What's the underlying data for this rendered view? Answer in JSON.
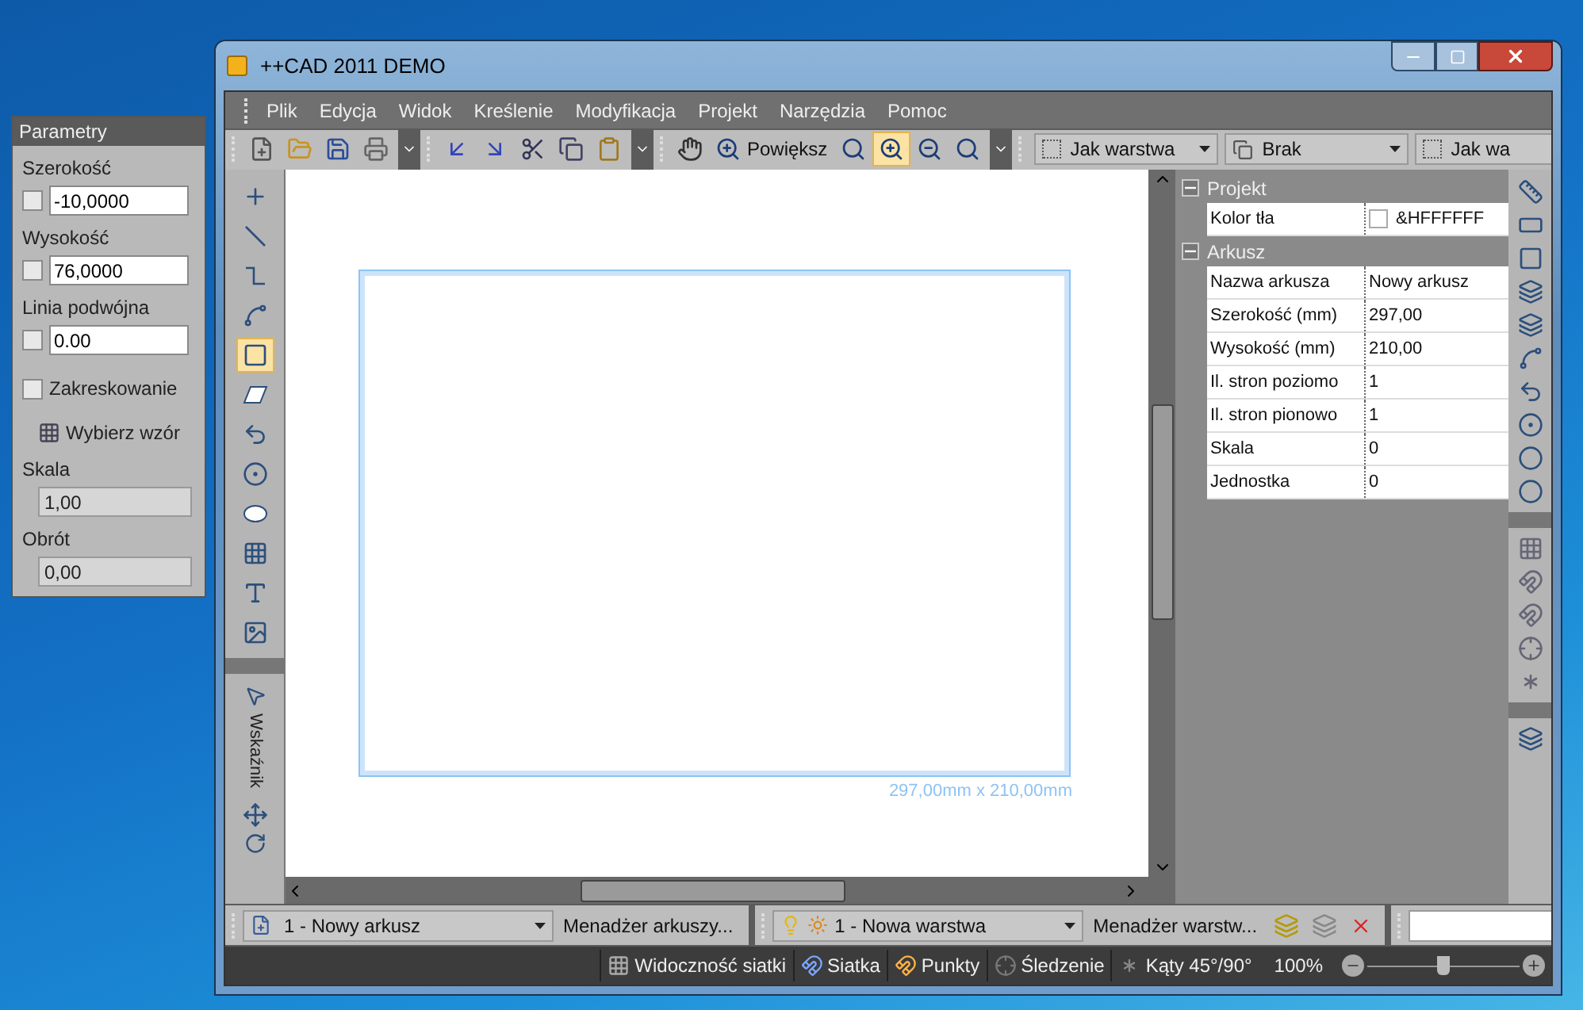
{
  "params_panel": {
    "title": "Parametry",
    "fields": [
      {
        "label": "Szerokość",
        "checked": false,
        "value": "-10,0000"
      },
      {
        "label": "Wysokość",
        "checked": false,
        "value": "76,0000"
      },
      {
        "label": "Linia podwójna",
        "checked": false,
        "value": "0.00"
      }
    ],
    "hatching": {
      "label": "Zakreskowanie",
      "checked": false
    },
    "pattern_button": "Wybierz wzór",
    "readonly_fields": [
      {
        "label": "Skala",
        "value": "1,00"
      },
      {
        "label": "Obrót",
        "value": "0,00"
      }
    ]
  },
  "window": {
    "title": "++CAD 2011 DEMO"
  },
  "menu": [
    "Plik",
    "Edycja",
    "Widok",
    "Kreślenie",
    "Modyfikacja",
    "Projekt",
    "Narzędzia",
    "Pomoc"
  ],
  "toolbar": {
    "zoom_label": "Powiększ",
    "zoom_tools": [
      {
        "kind": "window",
        "selected": false
      },
      {
        "kind": "in",
        "selected": true
      },
      {
        "kind": "out",
        "selected": false
      },
      {
        "kind": "all",
        "selected": false
      }
    ],
    "combos": [
      {
        "kind": "layer",
        "value": "Jak warstwa"
      },
      {
        "kind": "style",
        "value": "Brak"
      },
      {
        "kind": "layer",
        "value": "Jak wa"
      }
    ]
  },
  "left_tools": [
    {
      "kind": "point",
      "selected": false
    },
    {
      "kind": "line",
      "selected": false
    },
    {
      "kind": "polyline",
      "selected": false
    },
    {
      "kind": "curve",
      "selected": false
    },
    {
      "kind": "rect",
      "selected": true
    },
    {
      "kind": "parallelogram",
      "selected": false
    },
    {
      "kind": "arc",
      "selected": false
    },
    {
      "kind": "circle",
      "selected": false
    },
    {
      "kind": "ellipse",
      "selected": false
    },
    {
      "kind": "grid",
      "selected": false
    },
    {
      "kind": "text",
      "selected": false
    },
    {
      "kind": "image",
      "selected": false
    }
  ],
  "pointer_label": "Wskaźnik",
  "canvas": {
    "sheet_size": "297,00mm x 210,00mm"
  },
  "properties": [
    {
      "title": "Projekt",
      "expanded": true,
      "rows": [
        {
          "name": "Kolor tła",
          "value": "&HFFFFFF",
          "color": "#ffffff"
        }
      ]
    },
    {
      "title": "Arkusz",
      "expanded": true,
      "rows": [
        {
          "name": "Nazwa arkusza",
          "value": "Nowy arkusz"
        },
        {
          "name": "Szerokość (mm)",
          "value": "297,00"
        },
        {
          "name": "Wysokość (mm)",
          "value": "210,00"
        },
        {
          "name": "Il. stron poziomo",
          "value": "1"
        },
        {
          "name": "Il. stron pionowo",
          "value": "1"
        },
        {
          "name": "Skala",
          "value": "0"
        },
        {
          "name": "Jednostka",
          "value": "0"
        }
      ]
    }
  ],
  "bottom_bar": {
    "sheet": "1 - Nowy arkusz",
    "sheet_manager": "Menadżer arkuszy...",
    "layer": "1 - Nowa warstwa",
    "layer_manager": "Menadżer warstw..."
  },
  "status_bar": {
    "toggles": [
      {
        "kind": "grid",
        "label": "Widoczność siatki"
      },
      {
        "kind": "snap-grid",
        "label": "Siatka"
      },
      {
        "kind": "snap-points",
        "label": "Punkty"
      },
      {
        "kind": "tracking",
        "label": "Śledzenie"
      },
      {
        "kind": "angles",
        "label": "Kąty 45°/90°"
      }
    ],
    "zoom": "100%",
    "level": 0.5
  }
}
